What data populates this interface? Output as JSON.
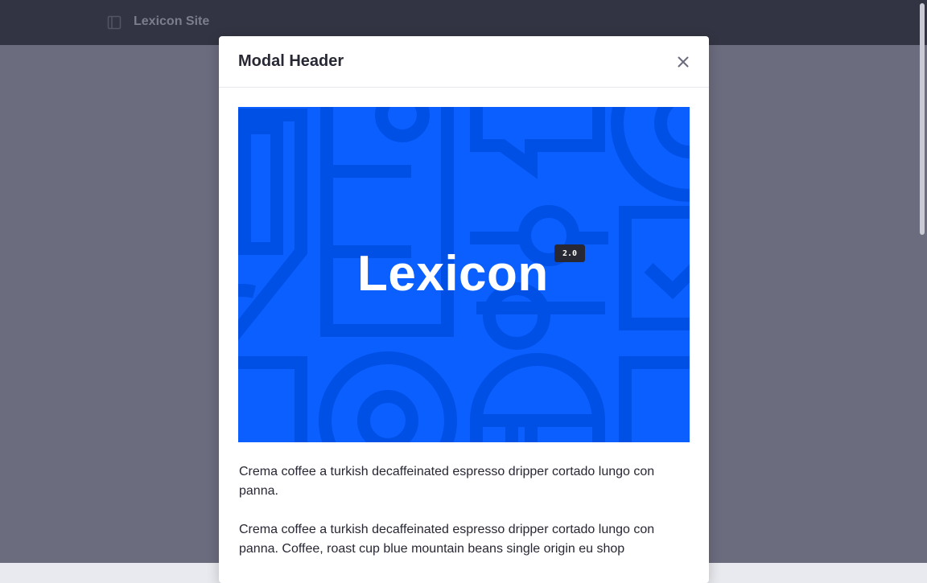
{
  "site": {
    "title": "Lexicon Site"
  },
  "modal": {
    "title": "Modal Header",
    "hero": {
      "title": "Lexicon",
      "badge": "2.0"
    },
    "paragraphs": [
      "Crema coffee a turkish decaffeinated espresso dripper cortado lungo con panna.",
      "Crema coffee a turkish decaffeinated espresso dripper cortado lungo con panna. Coffee, roast cup blue mountain beans single origin eu shop"
    ]
  },
  "colors": {
    "topbar": "#393a4a",
    "backdrop": "#6b6c7e",
    "hero_blue": "#0b5fff",
    "hero_pattern": "#0050e6"
  },
  "icons": {
    "sidebar_toggle": "sidebar-icon",
    "close": "close-icon"
  }
}
